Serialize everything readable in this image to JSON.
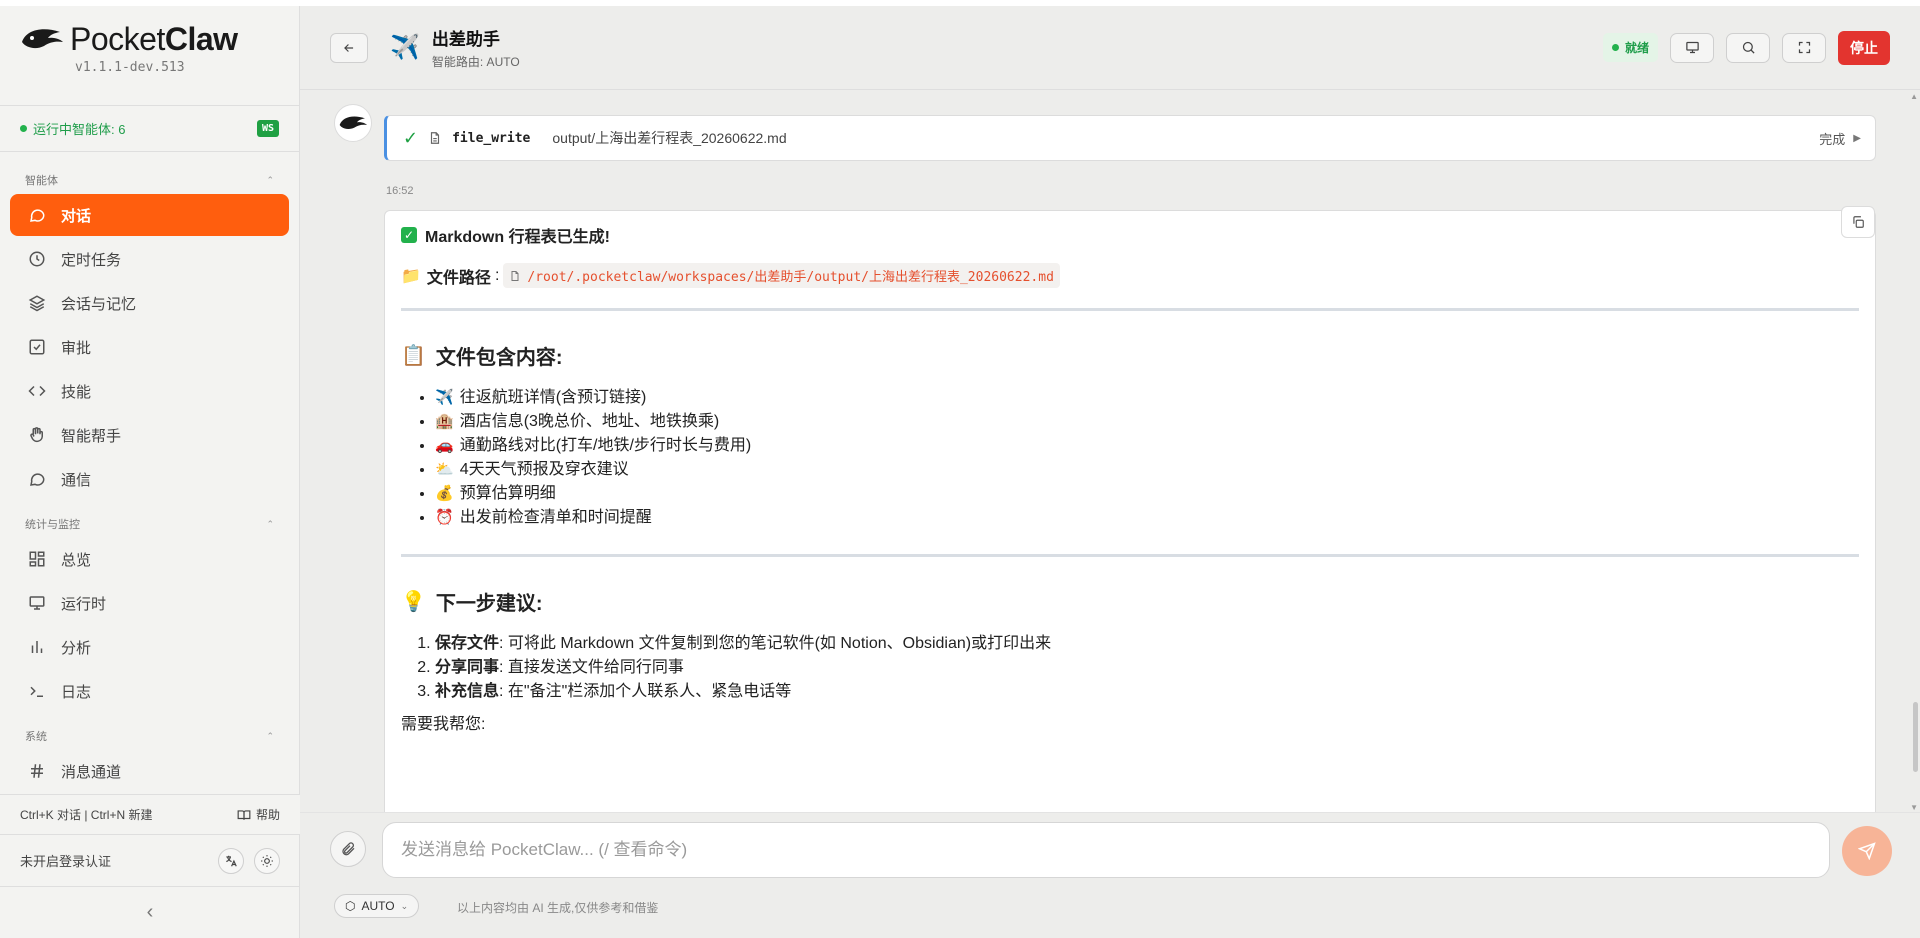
{
  "sidebar": {
    "brand_light": "Pocket",
    "brand_bold": "Claw",
    "version": "v1.1.1-dev.513",
    "agents_running": "运行中智能体: 6",
    "ws_badge": "WS",
    "sections": [
      {
        "title": "智能体",
        "items": [
          "对话",
          "定时任务",
          "会话与记忆",
          "审批",
          "技能",
          "智能帮手",
          "通信"
        ]
      },
      {
        "title": "统计与监控",
        "items": [
          "总览",
          "运行时",
          "分析",
          "日志"
        ]
      },
      {
        "title": "系统",
        "items": [
          "消息通道"
        ]
      }
    ],
    "active_item": "对话",
    "shortcuts": "Ctrl+K 对话 | Ctrl+N 新建",
    "help": "帮助",
    "auth_status": "未开启登录认证"
  },
  "header": {
    "icon": "✈️",
    "title": "出差助手",
    "subtitle": "智能路由: AUTO",
    "status": "就绪",
    "stop_label": "停止"
  },
  "chat": {
    "tool": {
      "name": "file_write",
      "path": "output/上海出差行程表_20260622.md",
      "status": "完成"
    },
    "time": "16:52",
    "message": {
      "line1": "Markdown 行程表已生成!",
      "path_label": "文件路径",
      "path_value": "/root/.pocketclaw/workspaces/出差助手/output/上海出差行程表_20260622.md",
      "section1_icon": "📋",
      "section1_title": "文件包含内容:",
      "items": [
        {
          "icon": "✈️",
          "text": "往返航班详情(含预订链接)"
        },
        {
          "icon": "🏨",
          "text": "酒店信息(3晚总价、地址、地铁换乘)"
        },
        {
          "icon": "🚗",
          "text": "通勤路线对比(打车/地铁/步行时长与费用)"
        },
        {
          "icon": "⛅",
          "text": "4天天气预报及穿衣建议"
        },
        {
          "icon": "💰",
          "text": "预算估算明细"
        },
        {
          "icon": "⏰",
          "text": "出发前检查清单和时间提醒"
        }
      ],
      "section2_icon": "💡",
      "section2_title": "下一步建议:",
      "steps": [
        {
          "bold": "保存文件",
          "text": ": 可将此 Markdown 文件复制到您的笔记软件(如 Notion、Obsidian)或打印出来"
        },
        {
          "bold": "分享同事",
          "text": ": 直接发送文件给同行同事"
        },
        {
          "bold": "补充信息",
          "text": ": 在\"备注\"栏添加个人联系人、紧急电话等"
        }
      ],
      "closing": "需要我帮您:"
    }
  },
  "composer": {
    "placeholder": "发送消息给 PocketClaw... (/ 查看命令)",
    "mode": "AUTO",
    "disclaimer": "以上内容均由 AI 生成,仅供参考和借鉴"
  },
  "colors": {
    "accent": "#ff5e0e",
    "stop": "#e3342f",
    "ready_green": "#1f9d4a",
    "code_text": "#e5502e"
  }
}
